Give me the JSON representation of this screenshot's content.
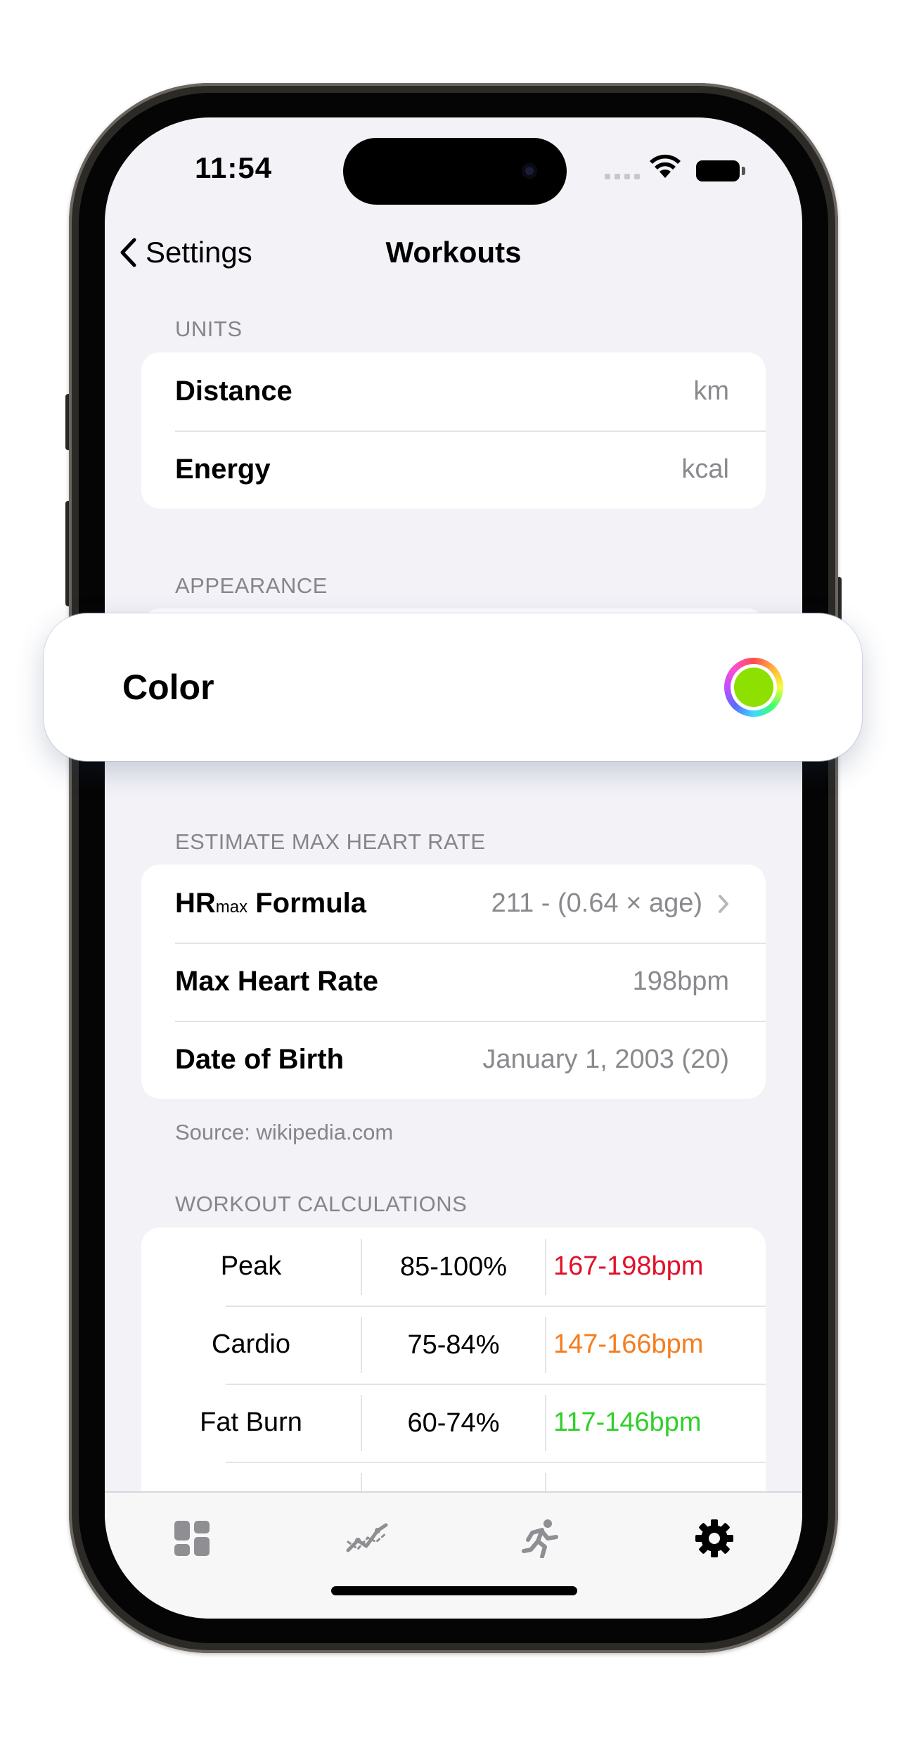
{
  "status_bar": {
    "time": "11:54"
  },
  "nav": {
    "back_label": "Settings",
    "title": "Workouts"
  },
  "units": {
    "header": "UNITS",
    "rows": [
      {
        "label": "Distance",
        "value": "km"
      },
      {
        "label": "Energy",
        "value": "kcal"
      }
    ]
  },
  "appearance": {
    "header": "APPEARANCE",
    "color_label": "Color",
    "color_value": "#8ee000"
  },
  "heart_rate": {
    "header": "ESTIMATE MAX HEART RATE",
    "formula_label_main": "HR",
    "formula_label_sub": "max",
    "formula_label_rest": " Formula",
    "formula_value": "211 - (0.64 × age)",
    "max_label": "Max Heart Rate",
    "max_value": "198bpm",
    "dob_label": "Date of Birth",
    "dob_value": "January 1, 2003 (20)",
    "footnote": "Source: wikipedia.com"
  },
  "calculations": {
    "header": "WORKOUT CALCULATIONS",
    "rows": [
      {
        "zone": "Peak",
        "percent": "85-100%",
        "range": "167-198bpm",
        "color": "#e0112b"
      },
      {
        "zone": "Cardio",
        "percent": "75-84%",
        "range": "147-166bpm",
        "color": "#f47d1e"
      },
      {
        "zone": "Fat Burn",
        "percent": "60-74%",
        "range": "117-146bpm",
        "color": "#2fcf2a"
      }
    ]
  },
  "tabs": [
    {
      "icon": "dashboard-icon",
      "active": false
    },
    {
      "icon": "trend-chart-icon",
      "active": false
    },
    {
      "icon": "running-icon",
      "active": false
    },
    {
      "icon": "gear-icon",
      "active": true
    }
  ]
}
